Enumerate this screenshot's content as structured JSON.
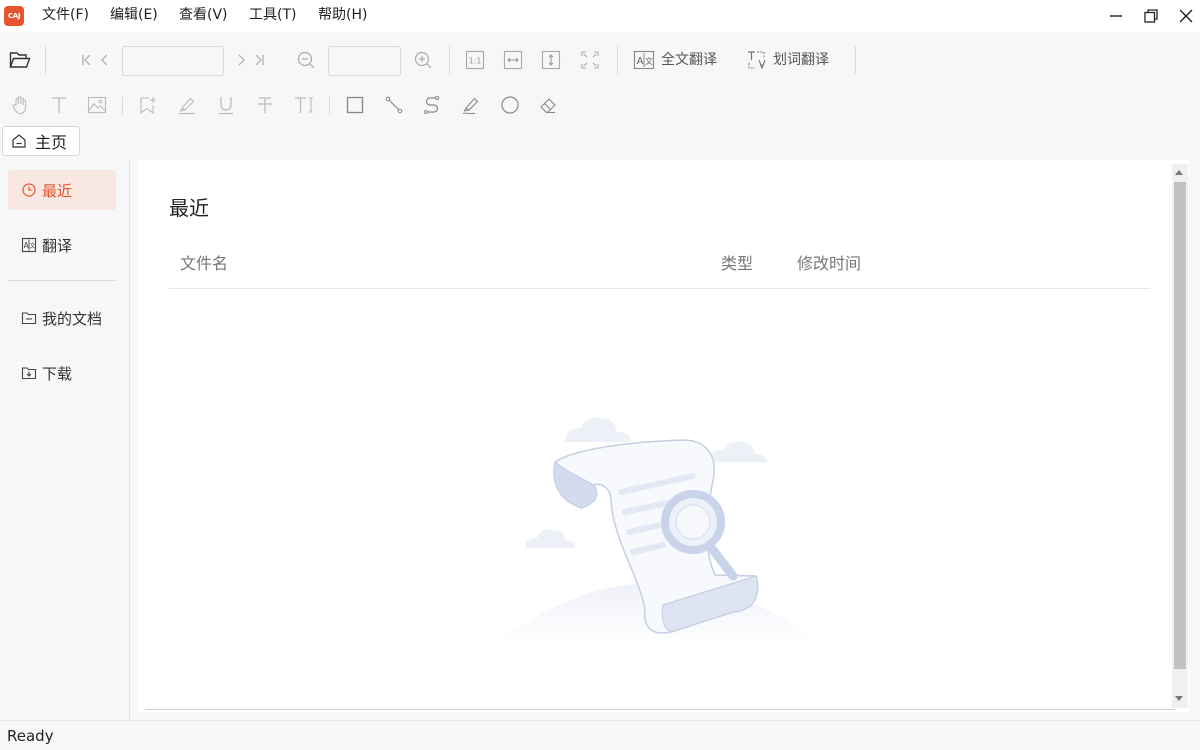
{
  "app": {
    "logo_text": "CAJ",
    "accent_color": "#e8542e"
  },
  "menubar": {
    "items": [
      "文件(F)",
      "编辑(E)",
      "查看(V)",
      "工具(T)",
      "帮助(H)"
    ]
  },
  "toolbar": {
    "page_input_value": "",
    "zoom_input_value": "",
    "full_translate_label": "全文翻译",
    "word_translate_label": "划词翻译"
  },
  "tabs": {
    "home_label": "主页"
  },
  "sidebar": {
    "items": [
      {
        "label": "最近",
        "icon": "clock-icon",
        "active": true
      },
      {
        "label": "翻译",
        "icon": "translate-icon",
        "active": false
      },
      {
        "label": "我的文档",
        "icon": "folder-icon",
        "active": false
      },
      {
        "label": "下载",
        "icon": "download-icon",
        "active": false
      }
    ]
  },
  "main": {
    "title": "最近",
    "columns": [
      "文件名",
      "类型",
      "修改时间"
    ],
    "rows": []
  },
  "statusbar": {
    "text": "Ready"
  }
}
